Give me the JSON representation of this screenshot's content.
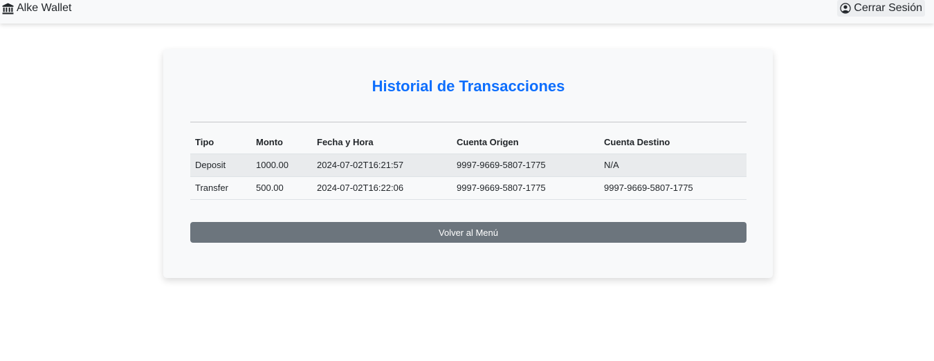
{
  "navbar": {
    "brand_icon": "bank-icon",
    "brand_label": "Alke Wallet",
    "logout_icon": "user-circle-icon",
    "logout_label": "Cerrar Sesión"
  },
  "main": {
    "title": "Historial de Transacciones",
    "columns": [
      "Tipo",
      "Monto",
      "Fecha y Hora",
      "Cuenta Origen",
      "Cuenta Destino"
    ],
    "rows": [
      [
        "Deposit",
        "1000.00",
        "2024-07-02T16:21:57",
        "9997-9669-5807-1775",
        "N/A"
      ],
      [
        "Transfer",
        "500.00",
        "2024-07-02T16:22:06",
        "9997-9669-5807-1775",
        "9997-9669-5807-1775"
      ]
    ],
    "back_button": "Volver al Menú"
  },
  "colors": {
    "title": "#0d6efd",
    "button": "#6c757d",
    "navbar": "#f8f9fa"
  }
}
